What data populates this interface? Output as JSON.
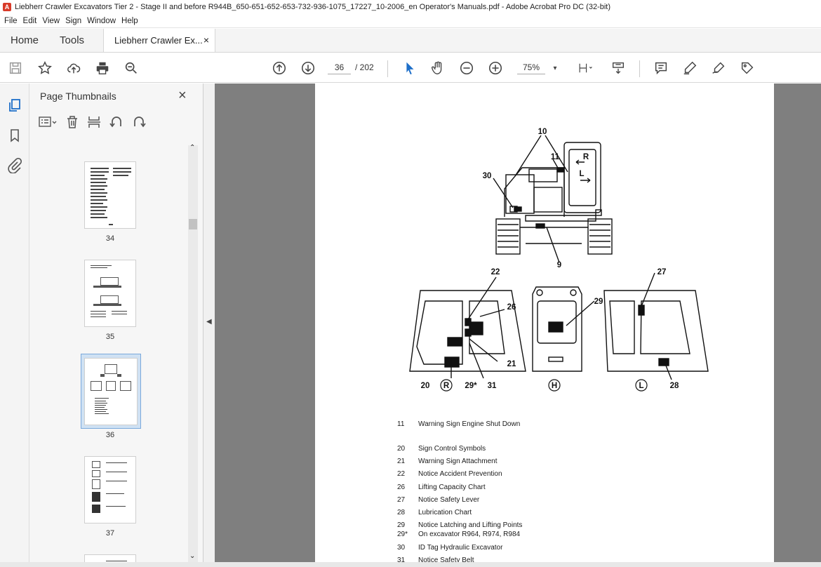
{
  "window": {
    "title": "Liebherr Crawler Excavators Tier 2 - Stage II and before  R944B_650-651-652-653-732-936-1075_17227_10-2006_en Operator's Manuals.pdf - Adobe Acrobat Pro DC (32-bit)"
  },
  "menu": [
    "File",
    "Edit",
    "View",
    "Sign",
    "Window",
    "Help"
  ],
  "tabs": {
    "home": "Home",
    "tools": "Tools",
    "document": "Liebherr Crawler Ex...",
    "close": "×"
  },
  "toolbar": {
    "page_current": "36",
    "page_total": "/ 202",
    "zoom": "75%"
  },
  "panel": {
    "title": "Page Thumbnails",
    "close": "×",
    "thumbnails": [
      {
        "label": "34"
      },
      {
        "label": "35"
      },
      {
        "label": "36",
        "selected": true
      },
      {
        "label": "37"
      }
    ]
  },
  "figure_labels": {
    "a10": "10",
    "a11": "11",
    "a30": "30",
    "a9": "9",
    "a22": "22",
    "a26": "26",
    "a21": "21",
    "a20": "20",
    "a29s": "29*",
    "a31": "31",
    "a29": "29",
    "a27": "27",
    "a28": "28",
    "circR": "R",
    "circH": "H",
    "circL": "L",
    "dirR": "R",
    "dirL": "L"
  },
  "legend": [
    {
      "num": "11",
      "text": "Warning Sign Engine Shut Down"
    },
    {
      "num": "20",
      "text": "Sign Control Symbols"
    },
    {
      "num": "21",
      "text": "Warning Sign Attachment"
    },
    {
      "num": "22",
      "text": "Notice Accident Prevention"
    },
    {
      "num": "26",
      "text": "Lifting Capacity Chart"
    },
    {
      "num": "27",
      "text": "Notice Safety Lever"
    },
    {
      "num": "28",
      "text": "Lubrication Chart"
    },
    {
      "num": "29",
      "text": "Notice Latching and Lifting Points"
    },
    {
      "num": "29*",
      "text": "On excavator R964, R974, R984"
    },
    {
      "num": "30",
      "text": "ID Tag Hydraulic Excavator"
    },
    {
      "num": "31",
      "text": "Notice Safety Belt"
    }
  ]
}
